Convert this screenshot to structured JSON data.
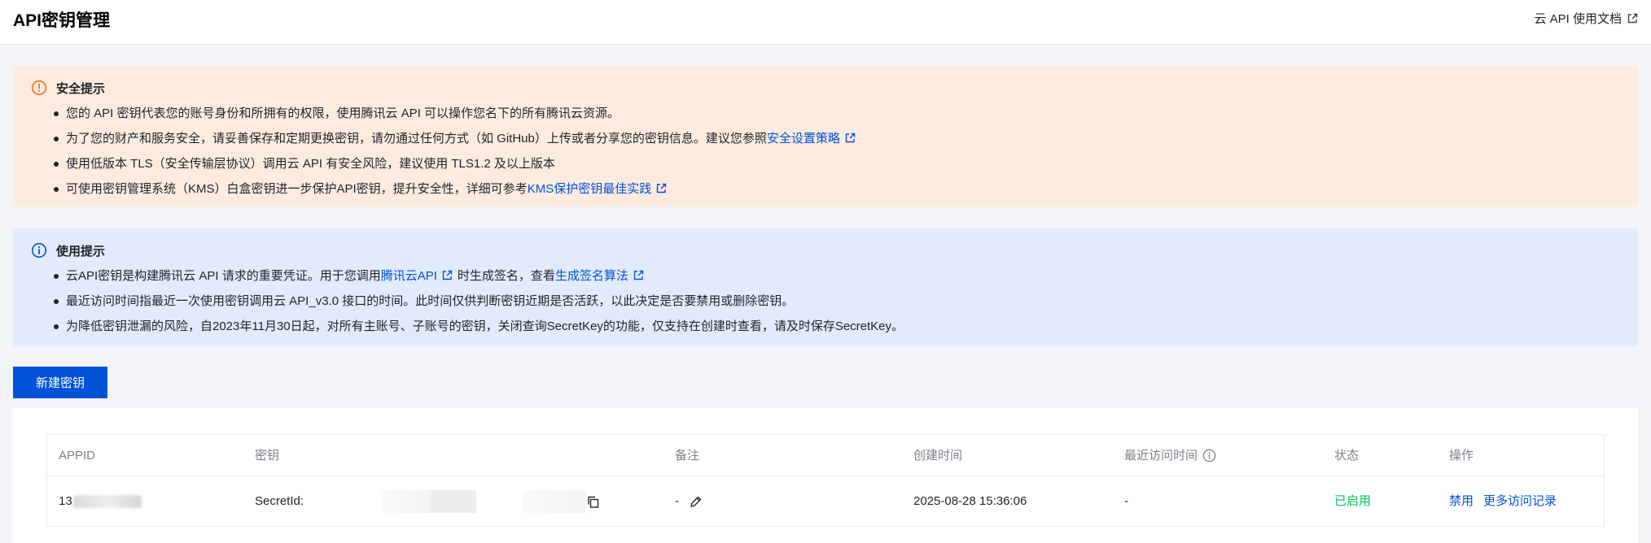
{
  "header": {
    "title": "API密钥管理",
    "doc_link": "云 API 使用文档"
  },
  "security_notice": {
    "title": "安全提示",
    "items": [
      {
        "text": "您的 API 密钥代表您的账号身份和所拥有的权限，使用腾讯云 API 可以操作您名下的所有腾讯云资源。"
      },
      {
        "text": "为了您的财产和服务安全，请妥善保存和定期更换密钥，请勿通过任何方式（如 GitHub）上传或者分享您的密钥信息。建议您参照",
        "link": "安全设置策略"
      },
      {
        "text": "使用低版本 TLS（安全传输层协议）调用云 API 有安全风险，建议使用 TLS1.2 及以上版本"
      },
      {
        "text": "可使用密钥管理系统（KMS）白盒密钥进一步保护API密钥，提升安全性，详细可参考",
        "link": "KMS保护密钥最佳实践"
      }
    ]
  },
  "usage_notice": {
    "title": "使用提示",
    "item1": {
      "pre": "云API密钥是构建腾讯云 API 请求的重要凭证。用于您调用",
      "link1": "腾讯云API",
      "mid": "时生成签名，查看",
      "link2": "生成签名算法"
    },
    "item2": "最近访问时间指最近一次使用密钥调用云 API_v3.0 接口的时间。此时间仅供判断密钥近期是否活跃，以此决定是否要禁用或删除密钥。",
    "item3": "为降低密钥泄漏的风险，自2023年11月30日起，对所有主账号、子账号的密钥，关闭查询SecretKey的功能，仅支持在创建时查看，请及时保存SecretKey。"
  },
  "actions": {
    "new_key_button": "新建密钥"
  },
  "table": {
    "columns": {
      "appid": "APPID",
      "key": "密钥",
      "remark": "备注",
      "created": "创建时间",
      "last_access": "最近访问时间",
      "status": "状态",
      "ops": "操作"
    },
    "rows": [
      {
        "appid_prefix": "13",
        "key_label": "SecretId:",
        "remark": "-",
        "created": "2025-08-28 15:36:06",
        "last_access": "-",
        "status": "已启用",
        "op_disable": "禁用",
        "op_more": "更多访问记录"
      }
    ]
  },
  "colors": {
    "primary": "#0052d9",
    "warn_bg": "#fdebe0",
    "warn_icon": "#e37318",
    "info_bg": "#e2ebfb",
    "status_enabled": "#0abf5b"
  },
  "icons": [
    "external-link-icon",
    "warning-circle-icon",
    "info-circle-icon",
    "copy-icon",
    "edit-pencil-icon"
  ]
}
